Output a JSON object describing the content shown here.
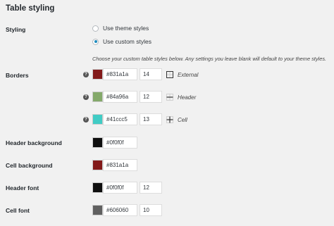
{
  "page": {
    "title": "Table styling"
  },
  "styling": {
    "label": "Styling",
    "options": [
      {
        "label": "Use theme styles",
        "checked": false
      },
      {
        "label": "Use custom styles",
        "checked": true
      }
    ],
    "hint": "Choose your custom table styles below. Any settings you leave blank will default to your theme styles."
  },
  "borders": {
    "label": "Borders",
    "items": [
      {
        "color": "#831a1a",
        "size": "14",
        "kind": "External",
        "icon": "border-outer-icon"
      },
      {
        "color": "#84a96a",
        "size": "12",
        "kind": "Header",
        "icon": "border-header-icon"
      },
      {
        "color": "#41ccc5",
        "size": "13",
        "kind": "Cell",
        "icon": "border-inner-icon"
      }
    ]
  },
  "header_background": {
    "label": "Header background",
    "color": "#0f0f0f"
  },
  "cell_background": {
    "label": "Cell background",
    "color": "#831a1a"
  },
  "header_font": {
    "label": "Header font",
    "color": "#0f0f0f",
    "size": "12"
  },
  "cell_font": {
    "label": "Cell font",
    "color": "#606060",
    "size": "10"
  },
  "help_icon": "help-icon",
  "help_glyph": "?"
}
